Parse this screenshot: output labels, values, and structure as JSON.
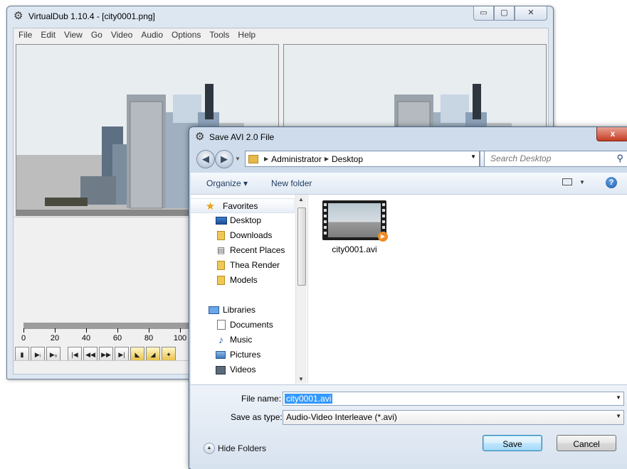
{
  "vdub": {
    "title": "VirtualDub 1.10.4 - [city0001.png]",
    "controls": {
      "minimize": "▭",
      "maximize": "▢",
      "close": "✕"
    },
    "menu": [
      "File",
      "Edit",
      "View",
      "Go",
      "Video",
      "Audio",
      "Options",
      "Tools",
      "Help"
    ],
    "timeline_ticks": [
      "0",
      "20",
      "40",
      "60",
      "80",
      "100"
    ],
    "toolbar_icons": [
      "stop-icon",
      "play-input-icon",
      "play-output-icon",
      "go-start-icon",
      "prev-frame-icon",
      "next-frame-icon",
      "go-end-icon",
      "mark-in-icon",
      "mark-out-icon",
      "scene-icon"
    ]
  },
  "dialog": {
    "title": "Save AVI 2.0 File",
    "close": "x",
    "address": {
      "root": "Administrator",
      "current": "Desktop"
    },
    "search_placeholder": "Search Desktop",
    "commands": {
      "organize": "Organize ▾",
      "new_folder": "New folder"
    },
    "nav": {
      "favorites_header": "Favorites",
      "favorites": [
        "Desktop",
        "Downloads",
        "Recent Places",
        "Thea Render",
        "Models"
      ],
      "libraries_header": "Libraries",
      "libraries": [
        "Documents",
        "Music",
        "Pictures",
        "Videos"
      ]
    },
    "files": [
      {
        "name": "city0001.avi"
      }
    ],
    "file_name_label": "File name:",
    "file_name_value": "city0001.avi",
    "save_type_label": "Save as type:",
    "save_type_value": "Audio-Video Interleave (*.avi)",
    "hide_folders": "Hide Folders",
    "save_button": "Save",
    "cancel_button": "Cancel"
  }
}
